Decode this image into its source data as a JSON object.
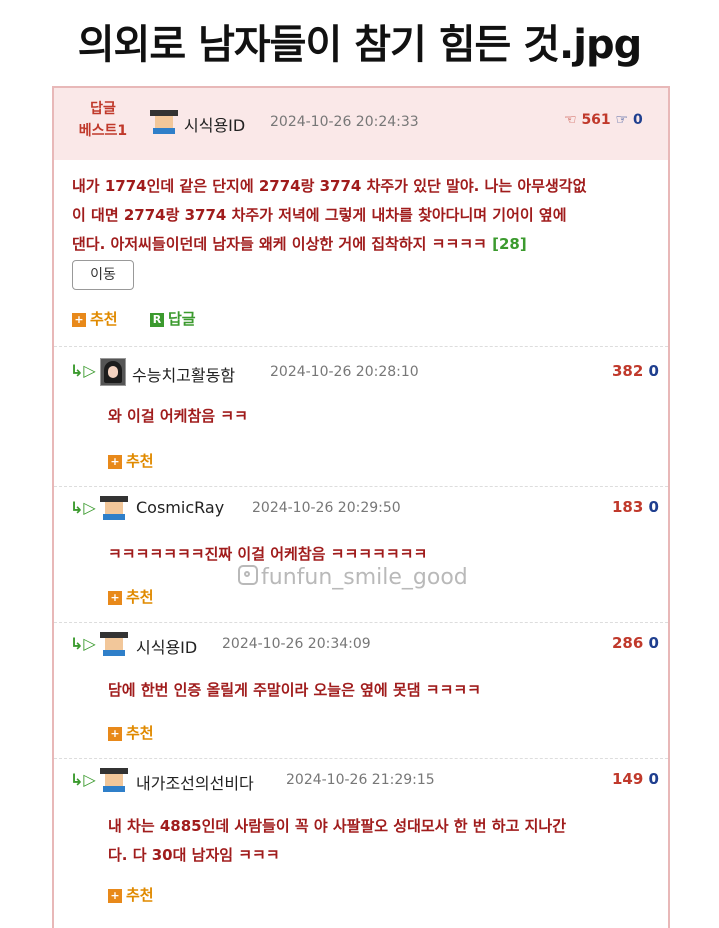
{
  "title": "의외로 남자들이 참기 힘든 것.jpg",
  "best": {
    "badge_line1": "답글",
    "badge_line2": "베스트1",
    "nickname": "시식용ID",
    "date": "2024-10-26 20:24:33",
    "up_count": "561",
    "down_count": "0",
    "body_lines": [
      "내가 1774인데 같은 단지에 2774랑 3774 차주가 있단 말야. 나는 아무생각없",
      "이 대면 2774랑 3774 차주가 저녁에 그렇게 내차를 찾아다니며 기어이 옆에",
      "댄다. 아저씨들이던데 남자들 왜케 이상한 거에 집착하지 ㅋㅋㅋㅋ"
    ],
    "reply_count": "[28]",
    "move_label": "이동",
    "recommend_label": "추천",
    "reply_label": "답글"
  },
  "comments": [
    {
      "nickname": "수능치고활동함",
      "date": "2024-10-26 20:28:10",
      "up": "382",
      "down": "0",
      "lines": [
        "와 이걸 어케참음 ㅋㅋ"
      ],
      "recommend_label": "추천"
    },
    {
      "nickname": "CosmicRay",
      "date": "2024-10-26 20:29:50",
      "up": "183",
      "down": "0",
      "lines": [
        "ㅋㅋㅋㅋㅋㅋㅋ진짜 이걸 어케참음 ㅋㅋㅋㅋㅋㅋㅋ"
      ],
      "recommend_label": "추천"
    },
    {
      "nickname": "시식용ID",
      "date": "2024-10-26 20:34:09",
      "up": "286",
      "down": "0",
      "lines": [
        "담에 한번 인증 올릴게 주말이라 오늘은 옆에 못댐 ㅋㅋㅋㅋ"
      ],
      "recommend_label": "추천"
    },
    {
      "nickname": "내가조선의선비다",
      "date": "2024-10-26 21:29:15",
      "up": "149",
      "down": "0",
      "lines": [
        "내 차는 4885인데 사람들이 꼭 야 사팔팔오 성대모사 한 번 하고 지나간",
        "다. 다 30대 남자임 ㅋㅋㅋ"
      ],
      "recommend_label": "추천"
    }
  ],
  "watermark": "funfun_smile_good",
  "icons": {
    "thumbs_up": "thumbs-up-icon",
    "thumbs_down": "thumbs-down-icon",
    "reply_arrow": "reply-arrow-icon",
    "plus": "plus-box-icon",
    "reply_r": "reply-r-icon",
    "instagram": "instagram-icon"
  },
  "colors": {
    "header_bg": "#fae8e8",
    "body_text": "#a01c1c",
    "accent_red": "#c0392b",
    "vote_blue": "#1f3f8f"
  }
}
